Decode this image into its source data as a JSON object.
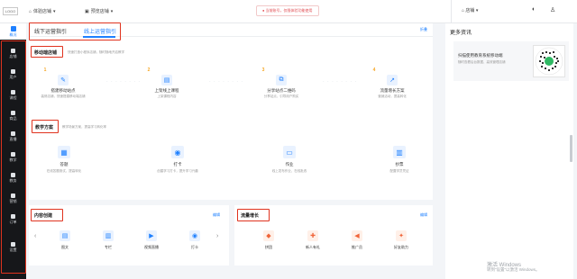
{
  "topbar": {
    "logo": "LOGO",
    "store_select": "体验店铺",
    "channel_select": "预览店铺",
    "notice": "当前账号，仅限体验功能使用",
    "right_store": "店铺"
  },
  "sidebar": {
    "items": [
      {
        "label": "概况",
        "icon": "home-icon"
      },
      {
        "label": "店铺",
        "icon": "store-icon"
      },
      {
        "label": "用户",
        "icon": "user-icon"
      },
      {
        "label": "课程",
        "icon": "course-icon"
      },
      {
        "label": "商品",
        "icon": "goods-icon"
      },
      {
        "label": "直播",
        "icon": "live-icon"
      },
      {
        "label": "教学",
        "icon": "teach-icon"
      },
      {
        "label": "教务",
        "icon": "academic-icon"
      },
      {
        "label": "营销",
        "icon": "marketing-icon"
      },
      {
        "label": "订单",
        "icon": "order-icon"
      },
      {
        "label": "设置",
        "icon": "settings-icon"
      }
    ]
  },
  "main": {
    "tabs": [
      {
        "label": "线下运营指引",
        "active": false
      },
      {
        "label": "线上运营指引",
        "active": true
      }
    ],
    "tabs_right_link": "折叠",
    "mobile_section": {
      "title": "移动端店铺",
      "subtitle": "快速打造小程序店铺，随时随地开启教学",
      "steps": [
        {
          "num": "1",
          "title": "搭建移动站点",
          "desc": "装修店铺，快速搭建移动端店铺",
          "icon": "✎"
        },
        {
          "num": "2",
          "title": "上架线上课程",
          "desc": "上架课程内容",
          "icon": "▤"
        },
        {
          "num": "3",
          "title": "分享站点二维码",
          "desc": "分享站点，引导用户购买",
          "icon": "⧉"
        },
        {
          "num": "4",
          "title": "流量增长方案",
          "desc": "营销活动，提高转化",
          "icon": "↗"
        }
      ]
    },
    "teaching_section": {
      "title": "教学方案",
      "subtitle": "教学场景方案，提高学习转化率",
      "items": [
        {
          "title": "答题",
          "desc": "在线答题测试，提高转化",
          "icon": "▦"
        },
        {
          "title": "打卡",
          "desc": "创建学习打卡，提升学习兴趣",
          "icon": "◉"
        },
        {
          "title": "作业",
          "desc": "线上发布作业，在线批改",
          "icon": "▭"
        },
        {
          "title": "抄票",
          "desc": "配置学员凭证",
          "icon": "▥"
        }
      ]
    },
    "content_section": {
      "title": "内容创建",
      "link": "编辑",
      "items": [
        {
          "title": "图文",
          "icon": "▤",
          "color": "#1e80ff",
          "bg": "#e9f2ff"
        },
        {
          "title": "专栏",
          "icon": "▥",
          "color": "#1e80ff",
          "bg": "#e9f2ff"
        },
        {
          "title": "视频直播",
          "icon": "▶",
          "color": "#1e80ff",
          "bg": "#e9f2ff"
        },
        {
          "title": "打卡",
          "icon": "◉",
          "color": "#1e80ff",
          "bg": "#e9f2ff"
        }
      ]
    },
    "growth_section": {
      "title": "流量增长",
      "link": "编辑",
      "items": [
        {
          "title": "拼团",
          "icon": "◆",
          "color": "#f0653a",
          "bg": "#fff0e8"
        },
        {
          "title": "新人有礼",
          "icon": "✚",
          "color": "#f0653a",
          "bg": "#fff0e8"
        },
        {
          "title": "推广员",
          "icon": "◀",
          "color": "#f0653a",
          "bg": "#fff0e8"
        },
        {
          "title": "好友助力",
          "icon": "✦",
          "color": "#f0653a",
          "bg": "#fff0e8"
        }
      ]
    }
  },
  "right_panel": {
    "title": "更多资讯",
    "qr_title": "扫描使用教育系统移动端",
    "qr_desc": "随时查看后台数据、高效管理店铺"
  },
  "watermark": {
    "line1": "激活 Windows",
    "line2": "转到“设置”以激活 Windows。"
  },
  "colors": {
    "accent": "#1e80ff",
    "highlight": "#e0331f",
    "sidebar_bg": "#16171a"
  }
}
